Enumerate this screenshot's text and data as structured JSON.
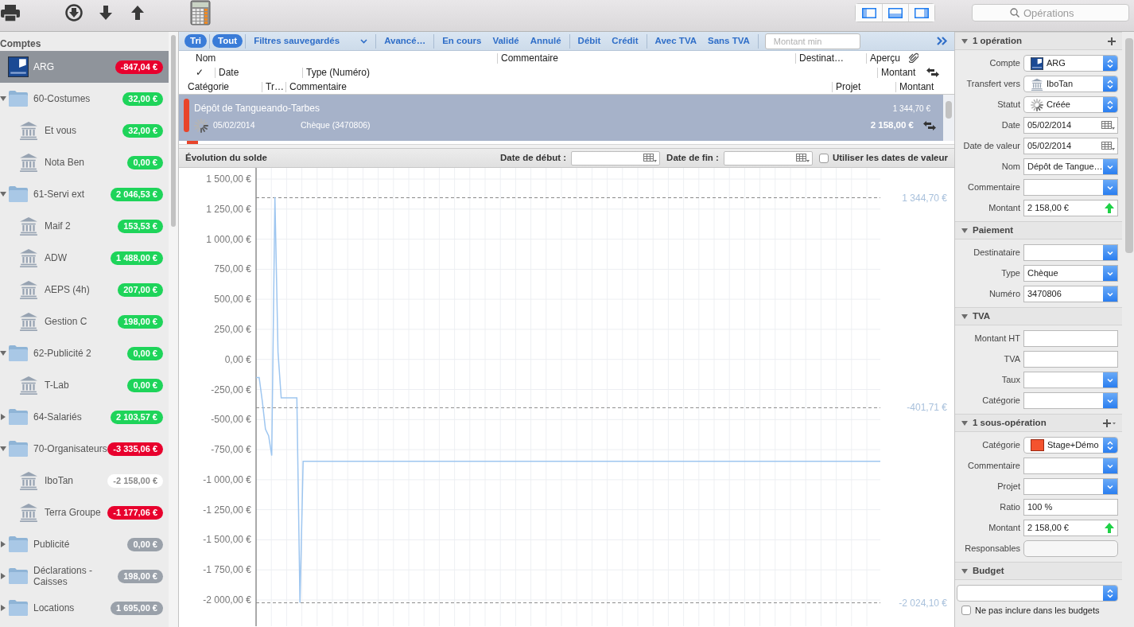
{
  "toolbar": {
    "search": {
      "placeholder": "Opérations"
    }
  },
  "sidebar": {
    "title": "Comptes",
    "accounts": [
      {
        "kind": "bank-logo",
        "name": "ARG",
        "balance": "-847,04 €",
        "color": "#e8002d",
        "selected": true
      },
      {
        "kind": "folder",
        "name": "60-Costumes",
        "balance": "32,00 €",
        "color": "#1ed45a",
        "selected": false,
        "expanded": true,
        "children": [
          {
            "kind": "institution",
            "name": "Et vous",
            "balance": "32,00 €",
            "color": "#1ed45a",
            "selected": false
          },
          {
            "kind": "institution",
            "name": "Nota Ben",
            "balance": "0,00 €",
            "color": "#1ed45a",
            "selected": false
          }
        ]
      },
      {
        "kind": "folder",
        "name": "61-Servi ext",
        "balance": "2 046,53 €",
        "color": "#1ed45a",
        "selected": false,
        "expanded": true,
        "children": [
          {
            "kind": "institution",
            "name": "Maif 2",
            "balance": "153,53 €",
            "color": "#1ed45a",
            "selected": false
          },
          {
            "kind": "institution",
            "name": "ADW",
            "balance": "1 488,00 €",
            "color": "#1ed45a",
            "selected": false
          },
          {
            "kind": "institution",
            "name": "AEPS (4h)",
            "balance": "207,00 €",
            "color": "#1ed45a",
            "selected": false
          },
          {
            "kind": "institution",
            "name": "Gestion C",
            "balance": "198,00 €",
            "color": "#1ed45a",
            "selected": false
          }
        ]
      },
      {
        "kind": "folder",
        "name": "62-Publicité 2",
        "balance": "0,00 €",
        "color": "#1ed45a",
        "selected": false,
        "expanded": true,
        "children": [
          {
            "kind": "institution",
            "name": "T-Lab",
            "balance": "0,00 €",
            "color": "#1ed45a",
            "selected": false
          }
        ]
      },
      {
        "kind": "folder",
        "name": "64-Salariés",
        "balance": "2 103,57 €",
        "color": "#1ed45a",
        "selected": false,
        "expanded": false
      },
      {
        "kind": "folder",
        "name": "70-Organisateurs",
        "balance": "-3 335,06 €",
        "color": "#e8002d",
        "selected": false,
        "expanded": true,
        "children": [
          {
            "kind": "institution",
            "name": "IboTan",
            "balance": "-2 158,00 €",
            "color": "#ffffff",
            "selected": false
          },
          {
            "kind": "institution",
            "name": "Terra Groupe",
            "balance": "-1 177,06 €",
            "color": "#e8002d",
            "selected": false
          }
        ]
      },
      {
        "kind": "folder",
        "name": "Publicité",
        "balance": "0,00 €",
        "color": "#9aa1aa",
        "selected": false,
        "expanded": false
      },
      {
        "kind": "folder",
        "name": "Déclarations - Caisses",
        "balance": "198,00 €",
        "color": "#9aa1aa",
        "selected": false,
        "expanded": false
      },
      {
        "kind": "folder",
        "name": "Locations",
        "balance": "1 695,00 €",
        "color": "#9aa1aa",
        "selected": false,
        "expanded": false
      }
    ]
  },
  "filters": {
    "groups": [
      [
        {
          "kind": "toggle",
          "label": "Tri",
          "selected": true
        }
      ],
      [
        {
          "kind": "toggle",
          "label": "Tout",
          "selected": true
        }
      ],
      [
        {
          "kind": "dropdown",
          "label": "Filtres sauvegardés",
          "selected": false
        }
      ],
      [
        {
          "kind": "toggle",
          "label": "Avancé…",
          "selected": false
        }
      ],
      [
        {
          "kind": "toggle",
          "label": "En cours",
          "selected": false
        },
        {
          "kind": "toggle",
          "label": "Validé",
          "selected": false
        },
        {
          "kind": "toggle",
          "label": "Annulé",
          "selected": false
        }
      ],
      [
        {
          "kind": "toggle",
          "label": "Débit",
          "selected": false
        },
        {
          "kind": "toggle",
          "label": "Crédit",
          "selected": false
        }
      ],
      [
        {
          "kind": "toggle",
          "label": "Avec TVA",
          "selected": false
        },
        {
          "kind": "toggle",
          "label": "Sans TVA",
          "selected": false
        }
      ]
    ],
    "amount_min": {
      "placeholder": "Montant min"
    }
  },
  "column_rows": [
    [
      "Nom",
      "Commentaire",
      "Destinat…",
      "Aperçu"
    ],
    [
      "✓",
      "Date",
      "Type (Numéro)",
      "Montant"
    ],
    [
      "Catégorie",
      "Tr…",
      "Commentaire",
      "Projet",
      "Montant"
    ]
  ],
  "transactions": [
    {
      "name": "Dépôt de Tangueando-Tarbes",
      "date": "05/02/2014",
      "type": "Chèque (3470806)",
      "balance": "1 344,70 €",
      "amount": "2 158,00 €",
      "color": "#e8442a",
      "selected": true
    }
  ],
  "balance_chart": {
    "title": "Évolution du solde",
    "start_label": "Date de début :",
    "end_label": "Date de fin :",
    "value_dates": {
      "label": "Utiliser les dates de valeur",
      "checked": false
    },
    "chart_data": {
      "type": "line",
      "ylim": [
        -2040,
        1500
      ],
      "yticks": [
        {
          "value": 1500,
          "label": "1 500,00 €"
        },
        {
          "value": 1250,
          "label": "1 250,00 €"
        },
        {
          "value": 1000,
          "label": "1 000,00 €"
        },
        {
          "value": 750,
          "label": "750,00 €"
        },
        {
          "value": 500,
          "label": "500,00 €"
        },
        {
          "value": 250,
          "label": "250,00 €"
        },
        {
          "value": 0,
          "label": "0,00 €"
        },
        {
          "value": -250,
          "label": "-250,00 €"
        },
        {
          "value": -500,
          "label": "-500,00 €"
        },
        {
          "value": -750,
          "label": "-750,00 €"
        },
        {
          "value": -1000,
          "label": "-1 000,00 €"
        },
        {
          "value": -1250,
          "label": "-1 250,00 €"
        },
        {
          "value": -1500,
          "label": "-1 500,00 €"
        },
        {
          "value": -1750,
          "label": "-1 750,00 €"
        },
        {
          "value": -2000,
          "label": "-2 000,00 €"
        }
      ],
      "categories": [
        null,
        null,
        null,
        null,
        null,
        null,
        null,
        null,
        null,
        null,
        null,
        null,
        null,
        null,
        null,
        null,
        null,
        null,
        null,
        null,
        null,
        null,
        null,
        null,
        null,
        null,
        null,
        null,
        null,
        null,
        null,
        null,
        null,
        null,
        null,
        null,
        null,
        null,
        null,
        null,
        null,
        null,
        null,
        null,
        null,
        null,
        null,
        null,
        null,
        null,
        null,
        null,
        null,
        null,
        null,
        null,
        null,
        null,
        null,
        null,
        null,
        null,
        null,
        null,
        null,
        null,
        null,
        null,
        null,
        null,
        null,
        null,
        null,
        null,
        null,
        null,
        null,
        null,
        null,
        null,
        null,
        null,
        null,
        null,
        null,
        null,
        null,
        null,
        null,
        null,
        null,
        null,
        null,
        null,
        null,
        null,
        null,
        null,
        null,
        null,
        null,
        null,
        null,
        null,
        null,
        null,
        null,
        null,
        null,
        null,
        null,
        null,
        null,
        null,
        null,
        null,
        null,
        null,
        null,
        null,
        null,
        null,
        null,
        null,
        null,
        null,
        null,
        null,
        null,
        null,
        null,
        null,
        null,
        null,
        null,
        null,
        null,
        null,
        null,
        null,
        null,
        null,
        null,
        null,
        null,
        null,
        null,
        null,
        null,
        null,
        null,
        null,
        null,
        null,
        null,
        null,
        null,
        null,
        null,
        null,
        null,
        null,
        null,
        null,
        null,
        null,
        null,
        null,
        null,
        null,
        null,
        null,
        null,
        null,
        null,
        null,
        null,
        null,
        null,
        null,
        null,
        null,
        null,
        null,
        null,
        null,
        null,
        null,
        null,
        null,
        null,
        null,
        null,
        null,
        null,
        null,
        null,
        null,
        null,
        null
      ],
      "series": [
        {
          "color": "#9ec6f0",
          "values": [
            -150,
            -150,
            -350,
            -580,
            -635,
            -800,
            1350,
            60,
            -320,
            -320,
            -320,
            -320,
            -320,
            -320,
            -2024,
            -847,
            -847,
            -847,
            -847,
            -847,
            -847,
            -847,
            -847,
            -847,
            -847,
            -847,
            -847,
            -847,
            -847,
            -847,
            -847,
            -847,
            -847,
            -847,
            -847,
            -847,
            -847,
            -847,
            -847,
            -847,
            -847,
            -847,
            -847,
            -847,
            -847,
            -847,
            -847,
            -847,
            -847,
            -847,
            -847,
            -847,
            -847,
            -847,
            -847,
            -847,
            -847,
            -847,
            -847,
            -847,
            -847,
            -847,
            -847,
            -847,
            -847,
            -847,
            -847,
            -847,
            -847,
            -847,
            -847,
            -847,
            -847,
            -847,
            -847,
            -847,
            -847,
            -847,
            -847,
            -847,
            -847,
            -847,
            -847,
            -847,
            -847,
            -847,
            -847,
            -847,
            -847,
            -847,
            -847,
            -847,
            -847,
            -847,
            -847,
            -847,
            -847,
            -847,
            -847,
            -847,
            -847,
            -847,
            -847,
            -847,
            -847,
            -847,
            -847,
            -847,
            -847,
            -847,
            -847,
            -847,
            -847,
            -847,
            -847,
            -847,
            -847,
            -847,
            -847,
            -847,
            -847,
            -847,
            -847,
            -847,
            -847,
            -847,
            -847,
            -847,
            -847,
            -847,
            -847,
            -847,
            -847,
            -847,
            -847,
            -847,
            -847,
            -847,
            -847,
            -847,
            -847,
            -847,
            -847,
            -847,
            -847,
            -847,
            -847,
            -847,
            -847,
            -847,
            -847,
            -847,
            -847,
            -847,
            -847,
            -847,
            -847,
            -847,
            -847,
            -847,
            -847,
            -847,
            -847,
            -847,
            -847,
            -847,
            -847,
            -847,
            -847,
            -847,
            -847,
            -847,
            -847,
            -847,
            -847,
            -847,
            -847,
            -847,
            -847,
            -847,
            -847,
            -847,
            -847,
            -847,
            -847,
            -847,
            -847,
            -847,
            -847,
            -847,
            -847,
            -847,
            -847,
            -847,
            -847,
            -847,
            -847,
            -847,
            -847,
            -847
          ]
        }
      ],
      "grid": true,
      "ref_lines": [
        {
          "axis": "y",
          "value": 1344.7,
          "label": "1 344,70 €"
        },
        {
          "axis": "y",
          "value": -401.71,
          "label": "-401,71 €"
        },
        {
          "axis": "y",
          "value": -2024.1,
          "label": "-2 024,10 €"
        }
      ]
    }
  },
  "inspector": {
    "sections": [
      {
        "title": "1 opération",
        "action": {
          "kind": "add"
        },
        "expanded": true,
        "fields": [
          {
            "label": "Compte",
            "kind": "popup",
            "value": {
              "kind": "bank-logo",
              "text": "ARG"
            }
          },
          {
            "label": "Transfert vers",
            "kind": "popup",
            "value": {
              "kind": "institution",
              "text": "IboTan"
            }
          },
          {
            "label": "Statut",
            "kind": "popup",
            "value": {
              "kind": "status",
              "text": "Créée"
            }
          },
          {
            "label": "Date",
            "kind": "date",
            "value": "05/02/2014"
          },
          {
            "label": "Date de valeur",
            "kind": "date",
            "value": "05/02/2014"
          },
          {
            "label": "Nom",
            "kind": "combo",
            "value": "Dépôt de Tangue…"
          },
          {
            "label": "Commentaire",
            "kind": "combo"
          },
          {
            "label": "Montant",
            "kind": "amount",
            "value": "2 158,00 €"
          }
        ]
      },
      {
        "title": "Paiement",
        "expanded": true,
        "fields": [
          {
            "label": "Destinataire",
            "kind": "combo"
          },
          {
            "label": "Type",
            "kind": "combo",
            "value": "Chèque"
          },
          {
            "label": "Numéro",
            "kind": "combo",
            "value": "3470806"
          }
        ]
      },
      {
        "title": "TVA",
        "expanded": true,
        "fields": [
          {
            "label": "Montant HT",
            "kind": "text"
          },
          {
            "label": "TVA",
            "kind": "text"
          },
          {
            "label": "Taux",
            "kind": "combo"
          },
          {
            "label": "Catégorie",
            "kind": "combo"
          }
        ]
      },
      {
        "title": "1 sous-opération",
        "action": {
          "kind": "add-menu"
        },
        "expanded": true,
        "fields": [
          {
            "label": "Catégorie",
            "kind": "popup",
            "value": {
              "kind": "category",
              "color": "#f4532f",
              "text": "Stage+Démo"
            }
          },
          {
            "label": "Commentaire",
            "kind": "combo"
          },
          {
            "label": "Projet",
            "kind": "combo"
          },
          {
            "label": "Ratio",
            "kind": "text",
            "value": "100 %"
          },
          {
            "label": "Montant",
            "kind": "amount",
            "value": "2 158,00 €"
          },
          {
            "label": "Responsables",
            "kind": "button"
          }
        ]
      },
      {
        "title": "Budget",
        "expanded": true,
        "fields": [
          {
            "kind": "popup"
          },
          {
            "kind": "checkbox",
            "label": "Ne pas inclure dans les budgets",
            "checked": false
          }
        ]
      }
    ]
  }
}
